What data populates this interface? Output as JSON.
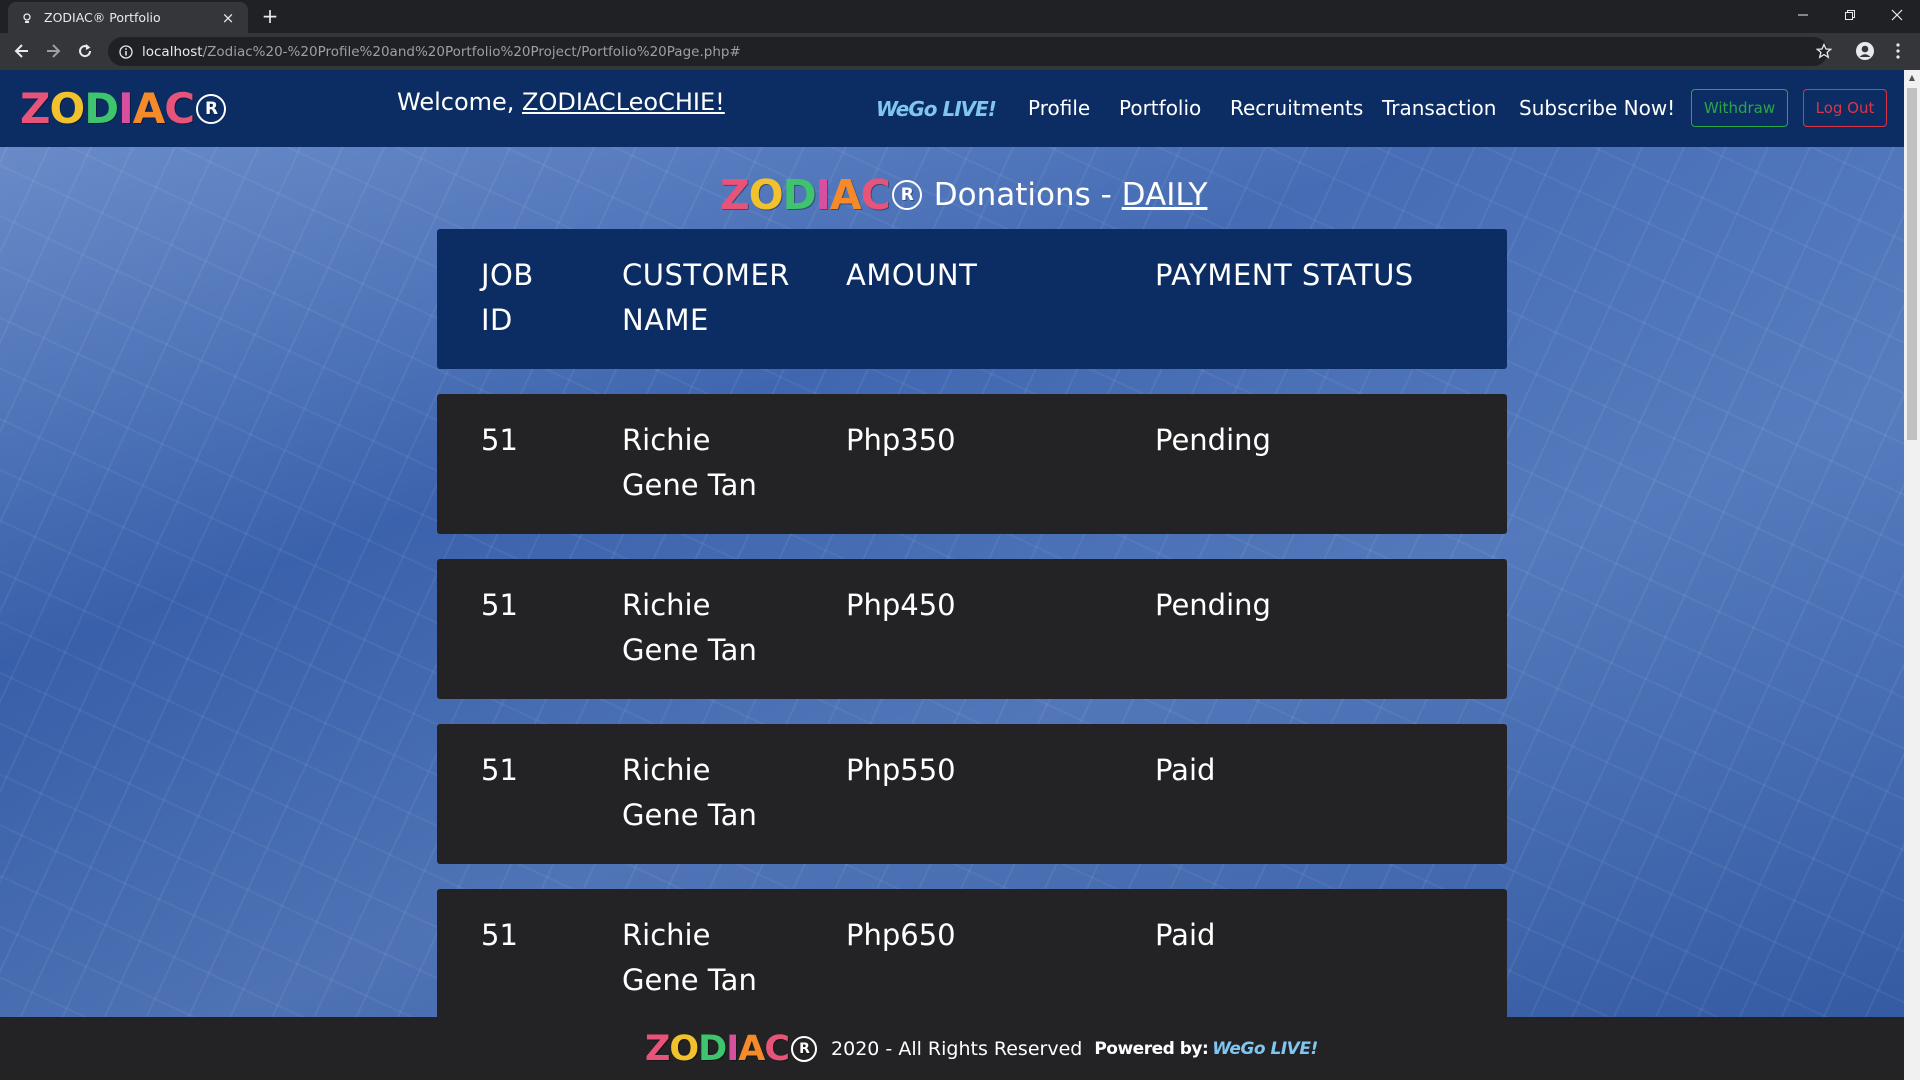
{
  "browser": {
    "tab_title": "ZODIAC® Portfolio",
    "tab_close": "×",
    "new_tab": "+",
    "url_host": "localhost",
    "url_path": "/Zodiac%20-%20Profile%20and%20Portfolio%20Project/Portfolio%20Page.php#"
  },
  "brand": {
    "letters": [
      "Z",
      "O",
      "D",
      "I",
      "A",
      "C"
    ],
    "letter_colors": [
      "#e8537a",
      "#f2c12e",
      "#3ec46d",
      "#d94fa0",
      "#f58a2a",
      "#e8537a"
    ],
    "registered": "R"
  },
  "navbar": {
    "welcome_prefix": "Welcome, ",
    "username": "ZODIACLeoCHIE!",
    "wego_logo": "WeGo LIVE!",
    "links": [
      "Profile",
      "Portfolio",
      "Recruitments",
      "Transaction",
      "Subscribe Now!"
    ],
    "withdraw_label": "Withdraw",
    "logout_label": "Log Out"
  },
  "heading": {
    "prefix": "Donations - ",
    "period": "DAILY"
  },
  "table": {
    "headers": [
      [
        "JOB",
        "ID"
      ],
      [
        "CUSTOMER",
        "NAME"
      ],
      [
        "AMOUNT"
      ],
      [
        "PAYMENT STATUS"
      ]
    ],
    "rows": [
      {
        "job_id": "51",
        "customer_line1": "Richie",
        "customer_line2": "Gene Tan",
        "amount": "Php350",
        "status": "Pending"
      },
      {
        "job_id": "51",
        "customer_line1": "Richie",
        "customer_line2": "Gene Tan",
        "amount": "Php450",
        "status": "Pending"
      },
      {
        "job_id": "51",
        "customer_line1": "Richie",
        "customer_line2": "Gene Tan",
        "amount": "Php550",
        "status": "Paid"
      },
      {
        "job_id": "51",
        "customer_line1": "Richie",
        "customer_line2": "Gene Tan",
        "amount": "Php650",
        "status": "Paid"
      }
    ]
  },
  "footer": {
    "copyright": "2020 - All Rights Reserved",
    "powered_by": "Powered by:",
    "powered_brand": "WeGo LIVE!"
  },
  "colors": {
    "navbar_bg": "#0c2d64",
    "row_bg": "#232325",
    "withdraw": "#28a745",
    "logout": "#dc3545",
    "wego": "#7fc6f0"
  }
}
